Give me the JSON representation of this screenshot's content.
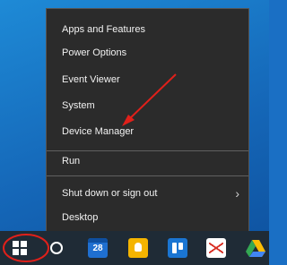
{
  "menu": {
    "items": [
      {
        "label": "Apps and Features"
      },
      {
        "label": "Power Options"
      },
      {
        "label": "Event Viewer"
      },
      {
        "label": "System"
      },
      {
        "label": "Device Manager"
      },
      {
        "label": "Run"
      },
      {
        "label": "Shut down or sign out"
      },
      {
        "label": "Desktop"
      }
    ]
  },
  "taskbar": {
    "calendar_date": "28",
    "icons": [
      "windows-start-icon",
      "cortana-search-icon",
      "calendar-app-icon",
      "google-keep-icon",
      "trello-icon",
      "gmail-icon",
      "google-drive-icon"
    ]
  },
  "annotations": {
    "arrow_color": "#e0201a",
    "circle_color": "#e0201a",
    "accent_color": "#2b2b2b"
  }
}
